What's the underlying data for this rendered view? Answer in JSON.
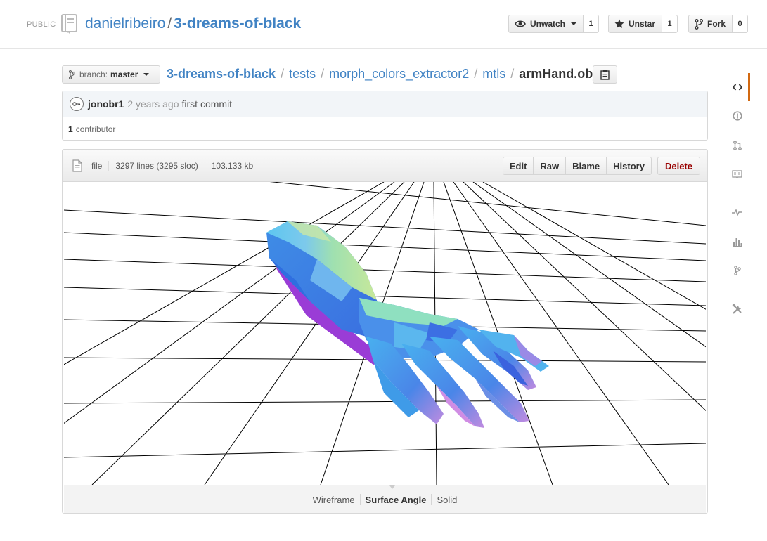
{
  "header": {
    "visibility": "PUBLIC",
    "owner": "danielribeiro",
    "separator": "/",
    "repo": "3-dreams-of-black",
    "actions": {
      "watch": {
        "label": "Unwatch",
        "count": "1",
        "icon": "eye-icon"
      },
      "star": {
        "label": "Unstar",
        "count": "1",
        "icon": "star-icon"
      },
      "fork": {
        "label": "Fork",
        "count": "0",
        "icon": "fork-icon"
      }
    }
  },
  "branch": {
    "prefix": "branch:",
    "name": "master"
  },
  "breadcrumb": {
    "root": "3-dreams-of-black",
    "sep": "/",
    "parts": [
      "tests",
      "morph_colors_extractor2",
      "mtls"
    ],
    "file": "armHand.obj"
  },
  "commit": {
    "author": "jonobr1",
    "time": "2 years ago",
    "message": "first commit",
    "contributors_count": "1",
    "contributors_label": "contributor"
  },
  "file": {
    "type": "file",
    "lines": "3297 lines (3295 sloc)",
    "size": "103.133 kb",
    "actions": [
      "Edit",
      "Raw",
      "Blame",
      "History"
    ],
    "delete_label": "Delete"
  },
  "render_modes": {
    "options": [
      "Wireframe",
      "Surface Angle",
      "Solid"
    ],
    "active": "Surface Angle"
  },
  "colors": {
    "link": "#4183c4",
    "danger": "#990000",
    "rail_selected": "#d26911",
    "model_cyan": "#56c7ee",
    "model_blue": "#3a7ee8",
    "model_purple": "#9a3cd6",
    "model_green": "#a8e6a0"
  },
  "sidebar": {
    "items": [
      "code-icon",
      "issues-icon",
      "pull-requests-icon",
      "wiki-icon",
      "pulse-icon",
      "graphs-icon",
      "network-icon",
      "settings-icon"
    ]
  }
}
